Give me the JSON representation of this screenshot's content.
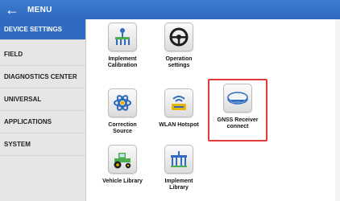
{
  "header": {
    "back_icon": "arrow-left-icon",
    "title": "MENU"
  },
  "sidebar": {
    "items": [
      {
        "label": "DEVICE SETTINGS",
        "active": true
      },
      {
        "label": "FIELD",
        "active": false
      },
      {
        "label": "DIAGNOSTICS CENTER",
        "active": false
      },
      {
        "label": "UNIVERSAL",
        "active": false
      },
      {
        "label": "APPLICATIONS",
        "active": false
      },
      {
        "label": "SYSTEM",
        "active": false
      }
    ]
  },
  "tiles": [
    {
      "line1": "Implement",
      "line2": "Calibration",
      "icon": "implement-calibration-icon"
    },
    {
      "line1": "Operation",
      "line2": "settings",
      "icon": "steering-wheel-icon"
    },
    {
      "line1": "Correction",
      "line2": "Source",
      "icon": "satellite-atom-icon"
    },
    {
      "line1": "WLAN Hotspot",
      "line2": "",
      "icon": "wifi-router-icon"
    },
    {
      "line1": "GNSS Receiver",
      "line2": "connect",
      "icon": "gnss-receiver-icon"
    },
    {
      "line1": "Vehicle Library",
      "line2": "",
      "icon": "tractor-icon"
    },
    {
      "line1": "Implement",
      "line2": "Library",
      "icon": "implement-library-icon"
    }
  ],
  "colors": {
    "accent": "#2f6bc0",
    "highlight": "#e03a3a",
    "sidebar_bg": "#e6e6e6"
  }
}
